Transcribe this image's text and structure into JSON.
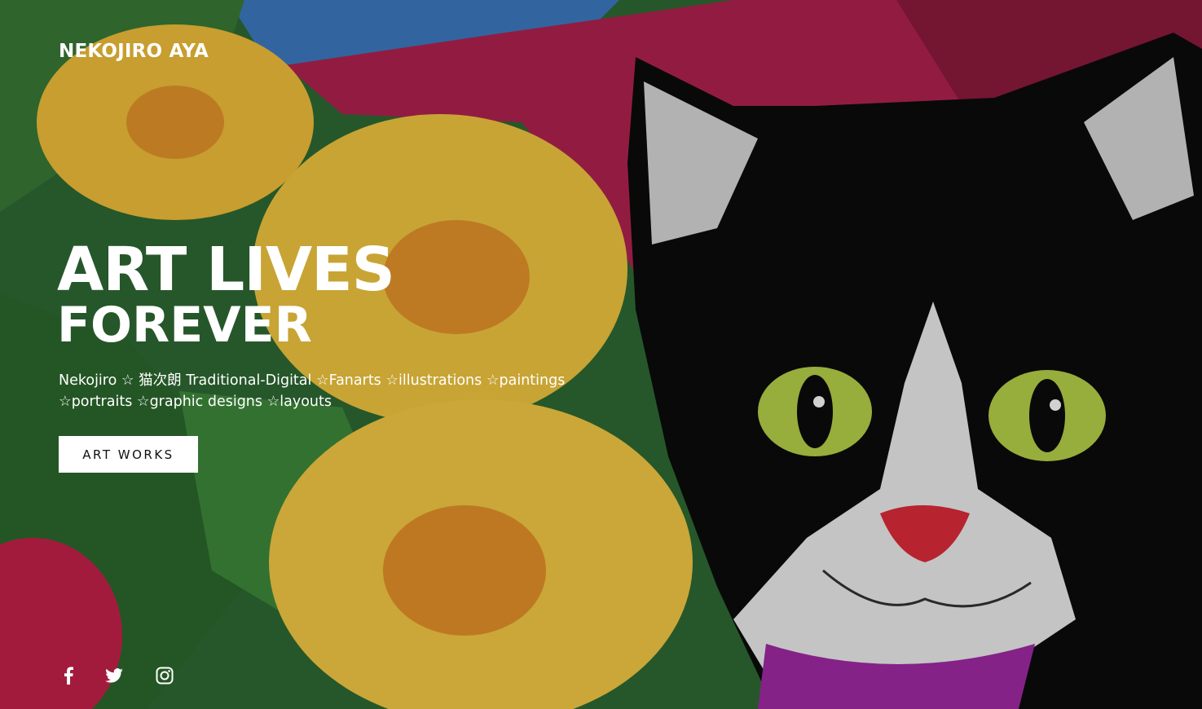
{
  "brand": {
    "name": "NEKOJIRO AYA"
  },
  "hero": {
    "headline_line1": "ART LIVES",
    "headline_line2": "FOREVER",
    "tagline": "Nekojiro ☆ 猫次朗 Traditional-Digital ☆Fanarts ☆illustrations ☆paintings ☆portraits ☆graphic designs ☆layouts",
    "cta_label": "ART WORKS"
  },
  "socials": [
    {
      "icon": "facebook-icon"
    },
    {
      "icon": "twitter-icon"
    },
    {
      "icon": "instagram-icon"
    }
  ],
  "colors": {
    "text": "#ffffff",
    "cta_bg": "#ffffff",
    "cta_text": "#111111"
  }
}
